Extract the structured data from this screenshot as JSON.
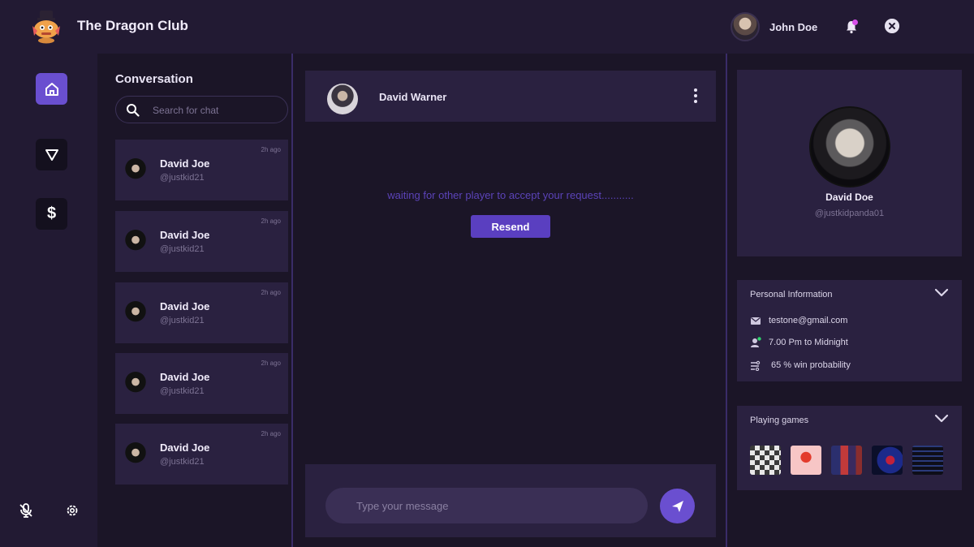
{
  "header": {
    "app_title": "The Dragon Club",
    "user_name": "John Doe",
    "icons": [
      "dragon-logo-icon",
      "bell-icon",
      "close-icon"
    ]
  },
  "sidebar": {
    "items": [
      {
        "icon": "home-icon",
        "active": true
      },
      {
        "icon": "triangle-icon",
        "active": false
      },
      {
        "icon": "dollar-icon",
        "label": "$",
        "active": false
      }
    ],
    "bottom_icons": [
      "mic-off-icon",
      "gear-icon"
    ]
  },
  "conversations": {
    "title": "Conversation",
    "search_placeholder": "Search for chat",
    "items": [
      {
        "name": "David Joe",
        "handle": "@justkid21",
        "time": "2h ago"
      },
      {
        "name": "David Joe",
        "handle": "@justkid21",
        "time": "2h ago"
      },
      {
        "name": "David Joe",
        "handle": "@justkid21",
        "time": "2h ago"
      },
      {
        "name": "David Joe",
        "handle": "@justkid21",
        "time": "2h ago"
      },
      {
        "name": "David Joe",
        "handle": "@justkid21",
        "time": "2h ago"
      }
    ]
  },
  "chat": {
    "contact_name": "David Warner",
    "waiting_text": "waiting for other player to accept your request...........",
    "resend_label": "Resend",
    "message_placeholder": "Type your message"
  },
  "profile": {
    "name": "David Doe",
    "handle": "@justkidpanda01"
  },
  "personal_info": {
    "title": "Personal Information",
    "email": "testone@gmail.com",
    "availability": "7.00 Pm to Midnight",
    "win_probability": "65 % win probability"
  },
  "playing_games": {
    "title": "Playing games",
    "games": [
      "chess-thumbnail",
      "mario-thumbnail",
      "fighters-thumbnail",
      "spider-hero-thumbnail",
      "keyboard-thumbnail"
    ]
  },
  "colors": {
    "background": "#1b1527",
    "panel": "#2a2140",
    "accent": "#6a4fd0",
    "waiting_text": "#5b43b8"
  }
}
